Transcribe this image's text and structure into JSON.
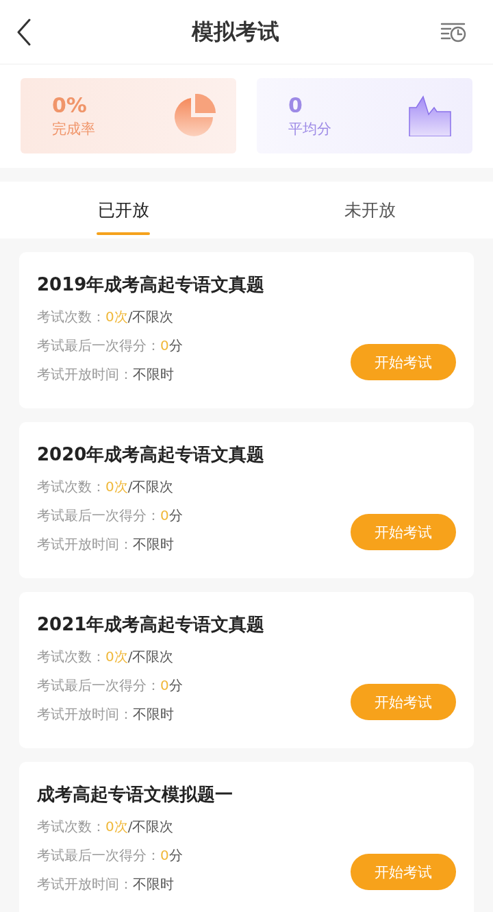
{
  "header": {
    "title": "模拟考试"
  },
  "stats": [
    {
      "kind": "pie",
      "value": "0%",
      "label": "完成率",
      "color": "#f0956a"
    },
    {
      "kind": "area",
      "value": "0",
      "label": "平均分",
      "color": "#9d8ae6"
    }
  ],
  "tabs": [
    {
      "label": "已开放",
      "selected": true
    },
    {
      "label": "未开放",
      "selected": false
    }
  ],
  "exams": [
    {
      "title": "2019年成考高起专语文真题",
      "rows": [
        {
          "label": "考试次数：",
          "highlight": "0次",
          "rest": "/不限次"
        },
        {
          "label": "考试最后一次得分：",
          "highlight": "0",
          "rest": "分"
        },
        {
          "label": "考试开放时间：",
          "rest": "不限时"
        }
      ],
      "button": "开始考试"
    },
    {
      "title": "2020年成考高起专语文真题",
      "rows": [
        {
          "label": "考试次数：",
          "highlight": "0次",
          "rest": "/不限次"
        },
        {
          "label": "考试最后一次得分：",
          "highlight": "0",
          "rest": "分"
        },
        {
          "label": "考试开放时间：",
          "rest": "不限时"
        }
      ],
      "button": "开始考试"
    },
    {
      "title": "2021年成考高起专语文真题",
      "rows": [
        {
          "label": "考试次数：",
          "highlight": "0次",
          "rest": "/不限次"
        },
        {
          "label": "考试最后一次得分：",
          "highlight": "0",
          "rest": "分"
        },
        {
          "label": "考试开放时间：",
          "rest": "不限时"
        }
      ],
      "button": "开始考试"
    },
    {
      "title": "成考高起专语文模拟题一",
      "rows": [
        {
          "label": "考试次数：",
          "highlight": "0次",
          "rest": "/不限次"
        },
        {
          "label": "考试最后一次得分：",
          "highlight": "0",
          "rest": "分"
        },
        {
          "label": "考试开放时间：",
          "rest": "不限时"
        }
      ],
      "button": "开始考试"
    }
  ]
}
